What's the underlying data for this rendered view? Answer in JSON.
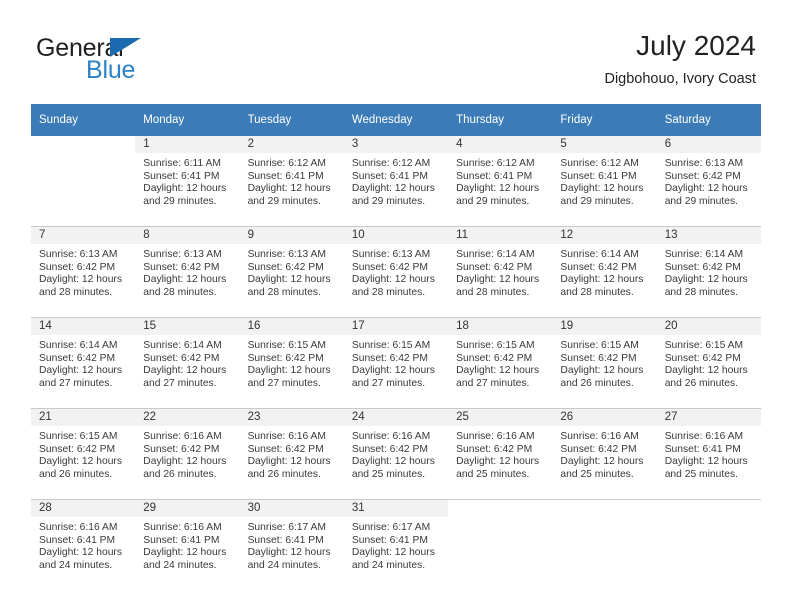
{
  "brand": {
    "word_one": "General",
    "word_two": "Blue",
    "triangle_color": "#1b6ab0",
    "blue_color": "#2b83c6",
    "dark_color": "#231f20"
  },
  "header": {
    "title": "July 2024",
    "subtitle": "Digbohouo, Ivory Coast"
  },
  "calendar": {
    "header_color": "#3b7cb8",
    "daynum_strip_color": "#f2f2f2",
    "weekdays": [
      "Sunday",
      "Monday",
      "Tuesday",
      "Wednesday",
      "Thursday",
      "Friday",
      "Saturday"
    ],
    "weeks": [
      [
        {
          "day": "",
          "sunrise": "",
          "sunset": "",
          "daylight_1": "",
          "daylight_2": ""
        },
        {
          "day": "1",
          "sunrise": "Sunrise: 6:11 AM",
          "sunset": "Sunset: 6:41 PM",
          "daylight_1": "Daylight: 12 hours",
          "daylight_2": "and 29 minutes."
        },
        {
          "day": "2",
          "sunrise": "Sunrise: 6:12 AM",
          "sunset": "Sunset: 6:41 PM",
          "daylight_1": "Daylight: 12 hours",
          "daylight_2": "and 29 minutes."
        },
        {
          "day": "3",
          "sunrise": "Sunrise: 6:12 AM",
          "sunset": "Sunset: 6:41 PM",
          "daylight_1": "Daylight: 12 hours",
          "daylight_2": "and 29 minutes."
        },
        {
          "day": "4",
          "sunrise": "Sunrise: 6:12 AM",
          "sunset": "Sunset: 6:41 PM",
          "daylight_1": "Daylight: 12 hours",
          "daylight_2": "and 29 minutes."
        },
        {
          "day": "5",
          "sunrise": "Sunrise: 6:12 AM",
          "sunset": "Sunset: 6:41 PM",
          "daylight_1": "Daylight: 12 hours",
          "daylight_2": "and 29 minutes."
        },
        {
          "day": "6",
          "sunrise": "Sunrise: 6:13 AM",
          "sunset": "Sunset: 6:42 PM",
          "daylight_1": "Daylight: 12 hours",
          "daylight_2": "and 29 minutes."
        }
      ],
      [
        {
          "day": "7",
          "sunrise": "Sunrise: 6:13 AM",
          "sunset": "Sunset: 6:42 PM",
          "daylight_1": "Daylight: 12 hours",
          "daylight_2": "and 28 minutes."
        },
        {
          "day": "8",
          "sunrise": "Sunrise: 6:13 AM",
          "sunset": "Sunset: 6:42 PM",
          "daylight_1": "Daylight: 12 hours",
          "daylight_2": "and 28 minutes."
        },
        {
          "day": "9",
          "sunrise": "Sunrise: 6:13 AM",
          "sunset": "Sunset: 6:42 PM",
          "daylight_1": "Daylight: 12 hours",
          "daylight_2": "and 28 minutes."
        },
        {
          "day": "10",
          "sunrise": "Sunrise: 6:13 AM",
          "sunset": "Sunset: 6:42 PM",
          "daylight_1": "Daylight: 12 hours",
          "daylight_2": "and 28 minutes."
        },
        {
          "day": "11",
          "sunrise": "Sunrise: 6:14 AM",
          "sunset": "Sunset: 6:42 PM",
          "daylight_1": "Daylight: 12 hours",
          "daylight_2": "and 28 minutes."
        },
        {
          "day": "12",
          "sunrise": "Sunrise: 6:14 AM",
          "sunset": "Sunset: 6:42 PM",
          "daylight_1": "Daylight: 12 hours",
          "daylight_2": "and 28 minutes."
        },
        {
          "day": "13",
          "sunrise": "Sunrise: 6:14 AM",
          "sunset": "Sunset: 6:42 PM",
          "daylight_1": "Daylight: 12 hours",
          "daylight_2": "and 28 minutes."
        }
      ],
      [
        {
          "day": "14",
          "sunrise": "Sunrise: 6:14 AM",
          "sunset": "Sunset: 6:42 PM",
          "daylight_1": "Daylight: 12 hours",
          "daylight_2": "and 27 minutes."
        },
        {
          "day": "15",
          "sunrise": "Sunrise: 6:14 AM",
          "sunset": "Sunset: 6:42 PM",
          "daylight_1": "Daylight: 12 hours",
          "daylight_2": "and 27 minutes."
        },
        {
          "day": "16",
          "sunrise": "Sunrise: 6:15 AM",
          "sunset": "Sunset: 6:42 PM",
          "daylight_1": "Daylight: 12 hours",
          "daylight_2": "and 27 minutes."
        },
        {
          "day": "17",
          "sunrise": "Sunrise: 6:15 AM",
          "sunset": "Sunset: 6:42 PM",
          "daylight_1": "Daylight: 12 hours",
          "daylight_2": "and 27 minutes."
        },
        {
          "day": "18",
          "sunrise": "Sunrise: 6:15 AM",
          "sunset": "Sunset: 6:42 PM",
          "daylight_1": "Daylight: 12 hours",
          "daylight_2": "and 27 minutes."
        },
        {
          "day": "19",
          "sunrise": "Sunrise: 6:15 AM",
          "sunset": "Sunset: 6:42 PM",
          "daylight_1": "Daylight: 12 hours",
          "daylight_2": "and 26 minutes."
        },
        {
          "day": "20",
          "sunrise": "Sunrise: 6:15 AM",
          "sunset": "Sunset: 6:42 PM",
          "daylight_1": "Daylight: 12 hours",
          "daylight_2": "and 26 minutes."
        }
      ],
      [
        {
          "day": "21",
          "sunrise": "Sunrise: 6:15 AM",
          "sunset": "Sunset: 6:42 PM",
          "daylight_1": "Daylight: 12 hours",
          "daylight_2": "and 26 minutes."
        },
        {
          "day": "22",
          "sunrise": "Sunrise: 6:16 AM",
          "sunset": "Sunset: 6:42 PM",
          "daylight_1": "Daylight: 12 hours",
          "daylight_2": "and 26 minutes."
        },
        {
          "day": "23",
          "sunrise": "Sunrise: 6:16 AM",
          "sunset": "Sunset: 6:42 PM",
          "daylight_1": "Daylight: 12 hours",
          "daylight_2": "and 26 minutes."
        },
        {
          "day": "24",
          "sunrise": "Sunrise: 6:16 AM",
          "sunset": "Sunset: 6:42 PM",
          "daylight_1": "Daylight: 12 hours",
          "daylight_2": "and 25 minutes."
        },
        {
          "day": "25",
          "sunrise": "Sunrise: 6:16 AM",
          "sunset": "Sunset: 6:42 PM",
          "daylight_1": "Daylight: 12 hours",
          "daylight_2": "and 25 minutes."
        },
        {
          "day": "26",
          "sunrise": "Sunrise: 6:16 AM",
          "sunset": "Sunset: 6:42 PM",
          "daylight_1": "Daylight: 12 hours",
          "daylight_2": "and 25 minutes."
        },
        {
          "day": "27",
          "sunrise": "Sunrise: 6:16 AM",
          "sunset": "Sunset: 6:41 PM",
          "daylight_1": "Daylight: 12 hours",
          "daylight_2": "and 25 minutes."
        }
      ],
      [
        {
          "day": "28",
          "sunrise": "Sunrise: 6:16 AM",
          "sunset": "Sunset: 6:41 PM",
          "daylight_1": "Daylight: 12 hours",
          "daylight_2": "and 24 minutes."
        },
        {
          "day": "29",
          "sunrise": "Sunrise: 6:16 AM",
          "sunset": "Sunset: 6:41 PM",
          "daylight_1": "Daylight: 12 hours",
          "daylight_2": "and 24 minutes."
        },
        {
          "day": "30",
          "sunrise": "Sunrise: 6:17 AM",
          "sunset": "Sunset: 6:41 PM",
          "daylight_1": "Daylight: 12 hours",
          "daylight_2": "and 24 minutes."
        },
        {
          "day": "31",
          "sunrise": "Sunrise: 6:17 AM",
          "sunset": "Sunset: 6:41 PM",
          "daylight_1": "Daylight: 12 hours",
          "daylight_2": "and 24 minutes."
        },
        {
          "day": "",
          "sunrise": "",
          "sunset": "",
          "daylight_1": "",
          "daylight_2": ""
        },
        {
          "day": "",
          "sunrise": "",
          "sunset": "",
          "daylight_1": "",
          "daylight_2": ""
        },
        {
          "day": "",
          "sunrise": "",
          "sunset": "",
          "daylight_1": "",
          "daylight_2": ""
        }
      ]
    ]
  }
}
